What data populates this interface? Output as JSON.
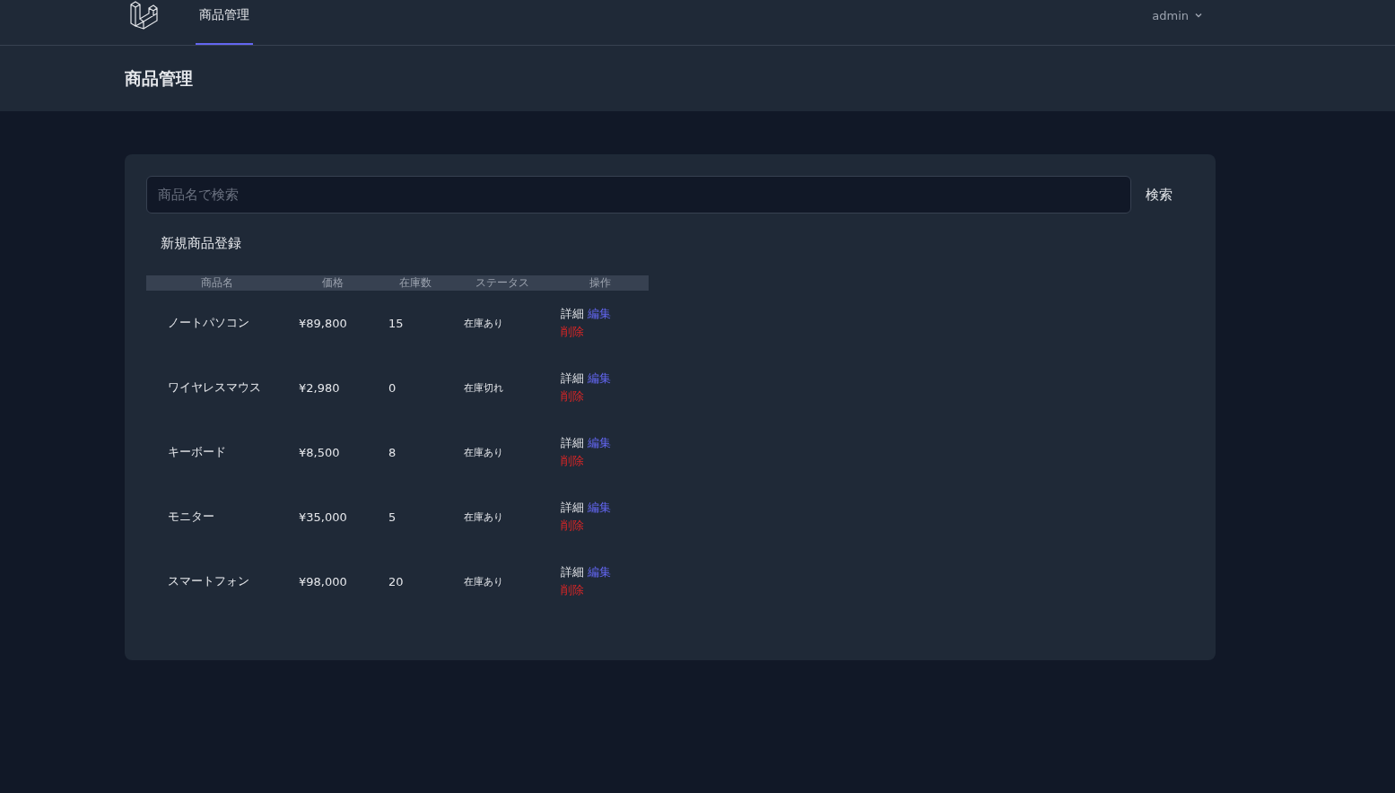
{
  "nav": {
    "tabs": [
      {
        "label": "商品管理",
        "selected": true
      }
    ],
    "user": "admin"
  },
  "header": {
    "title": "商品管理"
  },
  "search": {
    "placeholder": "商品名で検索",
    "button": "検索"
  },
  "create_link": "新規商品登録",
  "table": {
    "columns": [
      "商品名",
      "価格",
      "在庫数",
      "ステータス",
      "操作"
    ],
    "rows": [
      {
        "name": "ノートパソコン",
        "price": "¥89,800",
        "stock": "15",
        "status": "在庫あり",
        "actions": [
          {
            "label": "詳細",
            "kind": "view"
          },
          {
            "label": "編集",
            "kind": "edit"
          },
          {
            "label": "削除",
            "kind": "delete"
          }
        ]
      },
      {
        "name": "ワイヤレスマウス",
        "price": "¥2,980",
        "stock": "0",
        "status": "在庫切れ",
        "actions": [
          {
            "label": "詳細",
            "kind": "view"
          },
          {
            "label": "編集",
            "kind": "edit"
          },
          {
            "label": "削除",
            "kind": "delete"
          }
        ]
      },
      {
        "name": "キーボード",
        "price": "¥8,500",
        "stock": "8",
        "status": "在庫あり",
        "actions": [
          {
            "label": "詳細",
            "kind": "view"
          },
          {
            "label": "編集",
            "kind": "edit"
          },
          {
            "label": "削除",
            "kind": "delete"
          }
        ]
      },
      {
        "name": "モニター",
        "price": "¥35,000",
        "stock": "5",
        "status": "在庫あり",
        "actions": [
          {
            "label": "詳細",
            "kind": "view"
          },
          {
            "label": "編集",
            "kind": "edit"
          },
          {
            "label": "削除",
            "kind": "delete"
          }
        ]
      },
      {
        "name": "スマートフォン",
        "price": "¥98,000",
        "stock": "20",
        "status": "在庫あり",
        "actions": [
          {
            "label": "詳細",
            "kind": "view"
          },
          {
            "label": "編集",
            "kind": "edit"
          },
          {
            "label": "削除",
            "kind": "delete"
          }
        ]
      }
    ]
  }
}
